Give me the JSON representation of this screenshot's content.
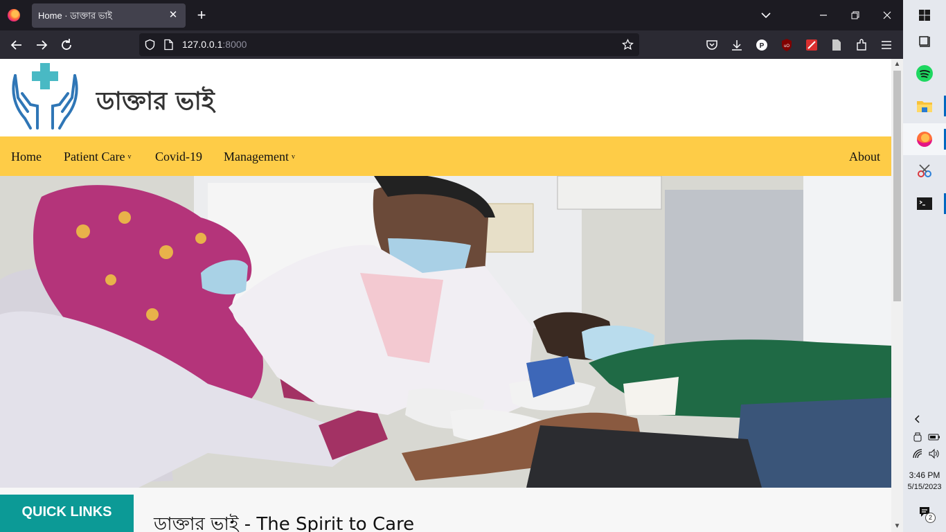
{
  "browser": {
    "tab": {
      "title": "Home · ডাক্তার ভাই",
      "close": "✕"
    },
    "new_tab": "+",
    "url": {
      "host": "127.0.0.1",
      "port": ":8000"
    }
  },
  "site": {
    "name": "ডাক্তার ভাই",
    "menu": [
      {
        "label": "Home",
        "has_dropdown": false
      },
      {
        "label": "Patient Care",
        "has_dropdown": true
      },
      {
        "label": "Covid-19",
        "has_dropdown": false
      },
      {
        "label": "Management",
        "has_dropdown": true
      },
      {
        "label": "About",
        "has_dropdown": false
      }
    ],
    "caret": "v",
    "hero_image": "medical-staff-drawing-blood-photo",
    "quick_links": "QUICK LINKS",
    "tagline": "ডাক্তার ভাই - The Spirit to Care"
  },
  "taskbar": {
    "clock": {
      "time": "3:46 PM",
      "date": "5/15/2023"
    },
    "notifications": "2",
    "apps": [
      "windows-start",
      "widgets",
      "spotify",
      "file-explorer",
      "firefox",
      "snipping-tool",
      "terminal"
    ]
  },
  "colors": {
    "menu_bg": "#fecc47",
    "quick_links_bg": "#0c9a96",
    "logo": "#2f76b6",
    "logo_cross": "#49b9c4"
  }
}
